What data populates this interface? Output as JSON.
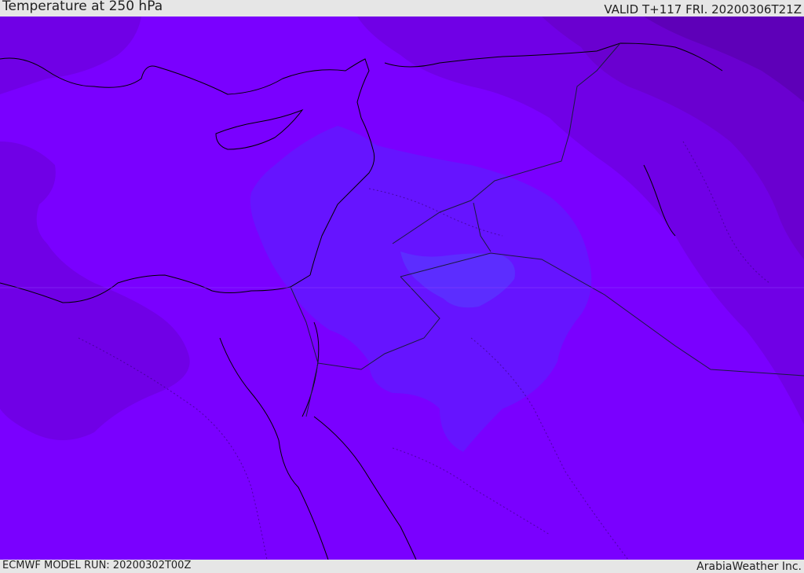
{
  "header": {
    "title": "Temperature at 250 hPa",
    "valid_time": "VALID T+117 FRI. 20200306T21Z"
  },
  "footer": {
    "model_run": "ECMWF MODEL RUN: 20200302T00Z",
    "credit": "ArabiaWeather Inc."
  },
  "map": {
    "field": "temperature_250hPa",
    "colors": {
      "base": "#7a00ff",
      "cold_band_1": "#7000e6",
      "cold_band_2": "#6a00d0",
      "cold_band_3": "#5e00b8",
      "warm_band": "#6614ff",
      "warm_core": "#5c2dff",
      "coastline": "#000000",
      "border": "#1a1a40"
    }
  }
}
